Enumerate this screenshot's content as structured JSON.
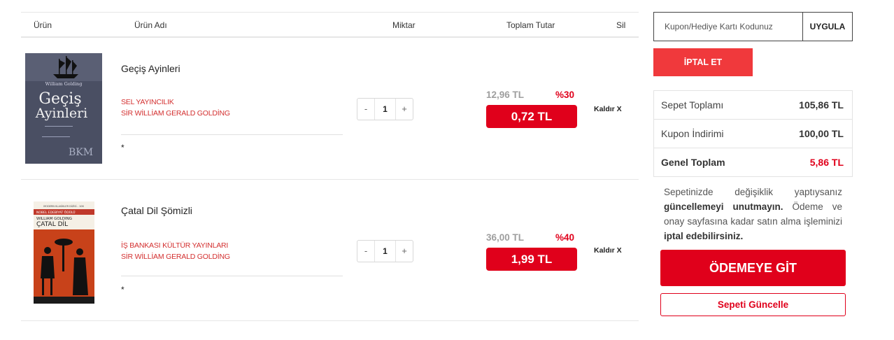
{
  "table": {
    "headers": {
      "product": "Ürün",
      "name": "Ürün Adı",
      "quantity": "Miktar",
      "total": "Toplam Tutar",
      "delete": "Sil"
    }
  },
  "items": [
    {
      "cover_text": {
        "author": "William Golding",
        "title_line1": "Geçiş",
        "title_line2": "Ayinleri",
        "publisher_logo": "BKM"
      },
      "title": "Geçiş Ayinleri",
      "publisher": "SEL YAYINCILIK",
      "author": "SİR WİLLİAM GERALD GOLDİNG",
      "extra": "*",
      "qty_minus": "-",
      "qty": "1",
      "qty_plus": "+",
      "old_price": "12,96 TL",
      "discount": "%30",
      "price": "0,72 TL",
      "remove": "Kaldır X"
    },
    {
      "cover_text": {
        "series": "MODERN KLASİKLER DİZİSİ - 106",
        "award": "NOBEL EDEBİYAT ÖDÜLÜ",
        "author": "WILLIAM GOLDING",
        "title": "ÇATAL DİL"
      },
      "title": "Çatal Dil Şömizli",
      "publisher": "İŞ BANKASI KÜLTÜR YAYINLARI",
      "author": "SİR WİLLİAM GERALD GOLDİNG",
      "extra": "*",
      "qty_minus": "-",
      "qty": "1",
      "qty_plus": "+",
      "old_price": "36,00 TL",
      "discount": "%40",
      "price": "1,99 TL",
      "remove": "Kaldır X"
    }
  ],
  "sidebar": {
    "coupon_placeholder": "Kupon/Hediye Kartı Kodunuz",
    "apply_label": "UYGULA",
    "cancel_label": "İPTAL ET",
    "summary": {
      "subtotal_label": "Sepet Toplamı",
      "subtotal": "105,86 TL",
      "discount_label": "Kupon İndirimi",
      "discount": "100,00 TL",
      "grand_label": "Genel Toplam",
      "grand": "5,86 TL"
    },
    "notice": {
      "p1": "Sepetinizde değişiklik yaptıysanız ",
      "b1": "güncellemeyi unutmayın.",
      "p2": " Ödeme ve onay sayfasına kadar satın alma işleminizi ",
      "b2": "iptal edebilirsiniz."
    },
    "checkout_label": "ÖDEMEYE GİT",
    "update_label": "Sepeti Güncelle"
  },
  "colors": {
    "brand_red": "#e0001b",
    "cancel_red": "#f0393c",
    "link_red": "#d32f2f"
  }
}
